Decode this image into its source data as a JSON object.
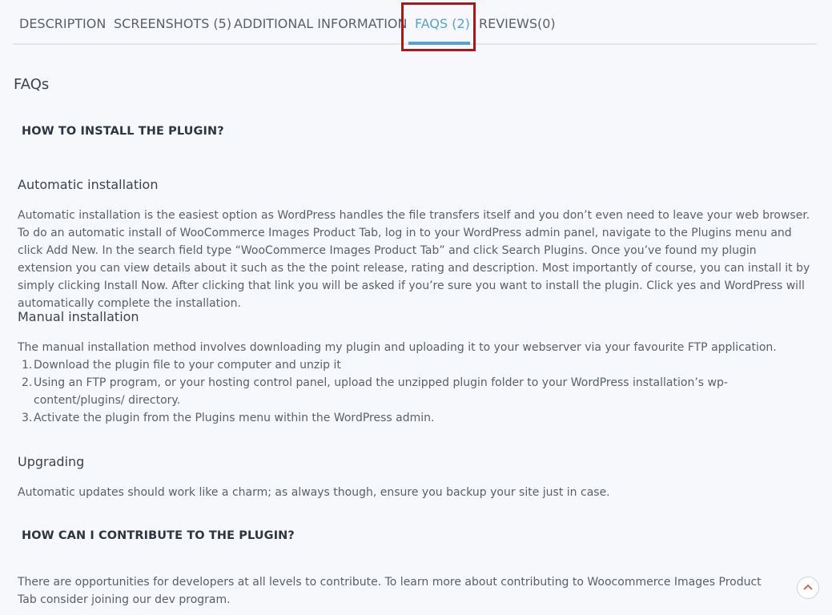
{
  "tabs": [
    {
      "label": "DESCRIPTION"
    },
    {
      "label": "SCREENSHOTS (5)"
    },
    {
      "label": "ADDITIONAL INFORMATION"
    },
    {
      "label": "FAQS (2)",
      "active": true
    },
    {
      "label": "REVIEWS(0)"
    }
  ],
  "section_title": "FAQs",
  "faqs": [
    {
      "question": "HOW TO INSTALL THE PLUGIN?",
      "automatic": {
        "heading": "Automatic installation",
        "text": "Automatic installation is the easiest option as WordPress handles the file transfers itself and you don’t even need to leave your web browser. To do an automatic install of WooCommerce Images Product Tab, log in to your WordPress admin panel, navigate to the Plugins menu and click Add New. In the search field type “WooCommerce Images Product Tab” and click Search Plugins. Once you’ve found my plugin extension you can view details about it such as the the point release, rating and description. Most importantly of course, you can install it by simply clicking Install Now. After clicking that link you will be asked if you’re sure you want to install the plugin. Click yes and WordPress will automatically complete the installation."
      },
      "manual": {
        "heading": "Manual installation",
        "intro": "The manual installation method involves downloading my plugin and uploading it to your webserver via your favourite FTP application.",
        "steps": [
          {
            "num": "1.",
            "text": "Download the plugin file to your computer and unzip it"
          },
          {
            "num": "2.",
            "text": "Using an FTP program, or your hosting control panel, upload the unzipped plugin folder to your WordPress installation’s wp-content/plugins/ directory."
          },
          {
            "num": "3.",
            "text": "Activate the plugin from the Plugins menu within the WordPress admin."
          }
        ]
      },
      "upgrading": {
        "heading": "Upgrading",
        "text": "Automatic updates should work like a charm; as always though, ensure you backup your site just in case."
      }
    },
    {
      "question": "HOW CAN I CONTRIBUTE TO THE PLUGIN?",
      "text": "There are opportunities for developers at all levels to contribute. To learn more about contributing to Woocommerce Images Product Tab consider joining our dev program."
    }
  ],
  "scroll_top_icon": "chevron-up-icon",
  "colors": {
    "accent": "#5b9fd1",
    "highlight": "#e00000",
    "background": "#f7f8fb"
  }
}
